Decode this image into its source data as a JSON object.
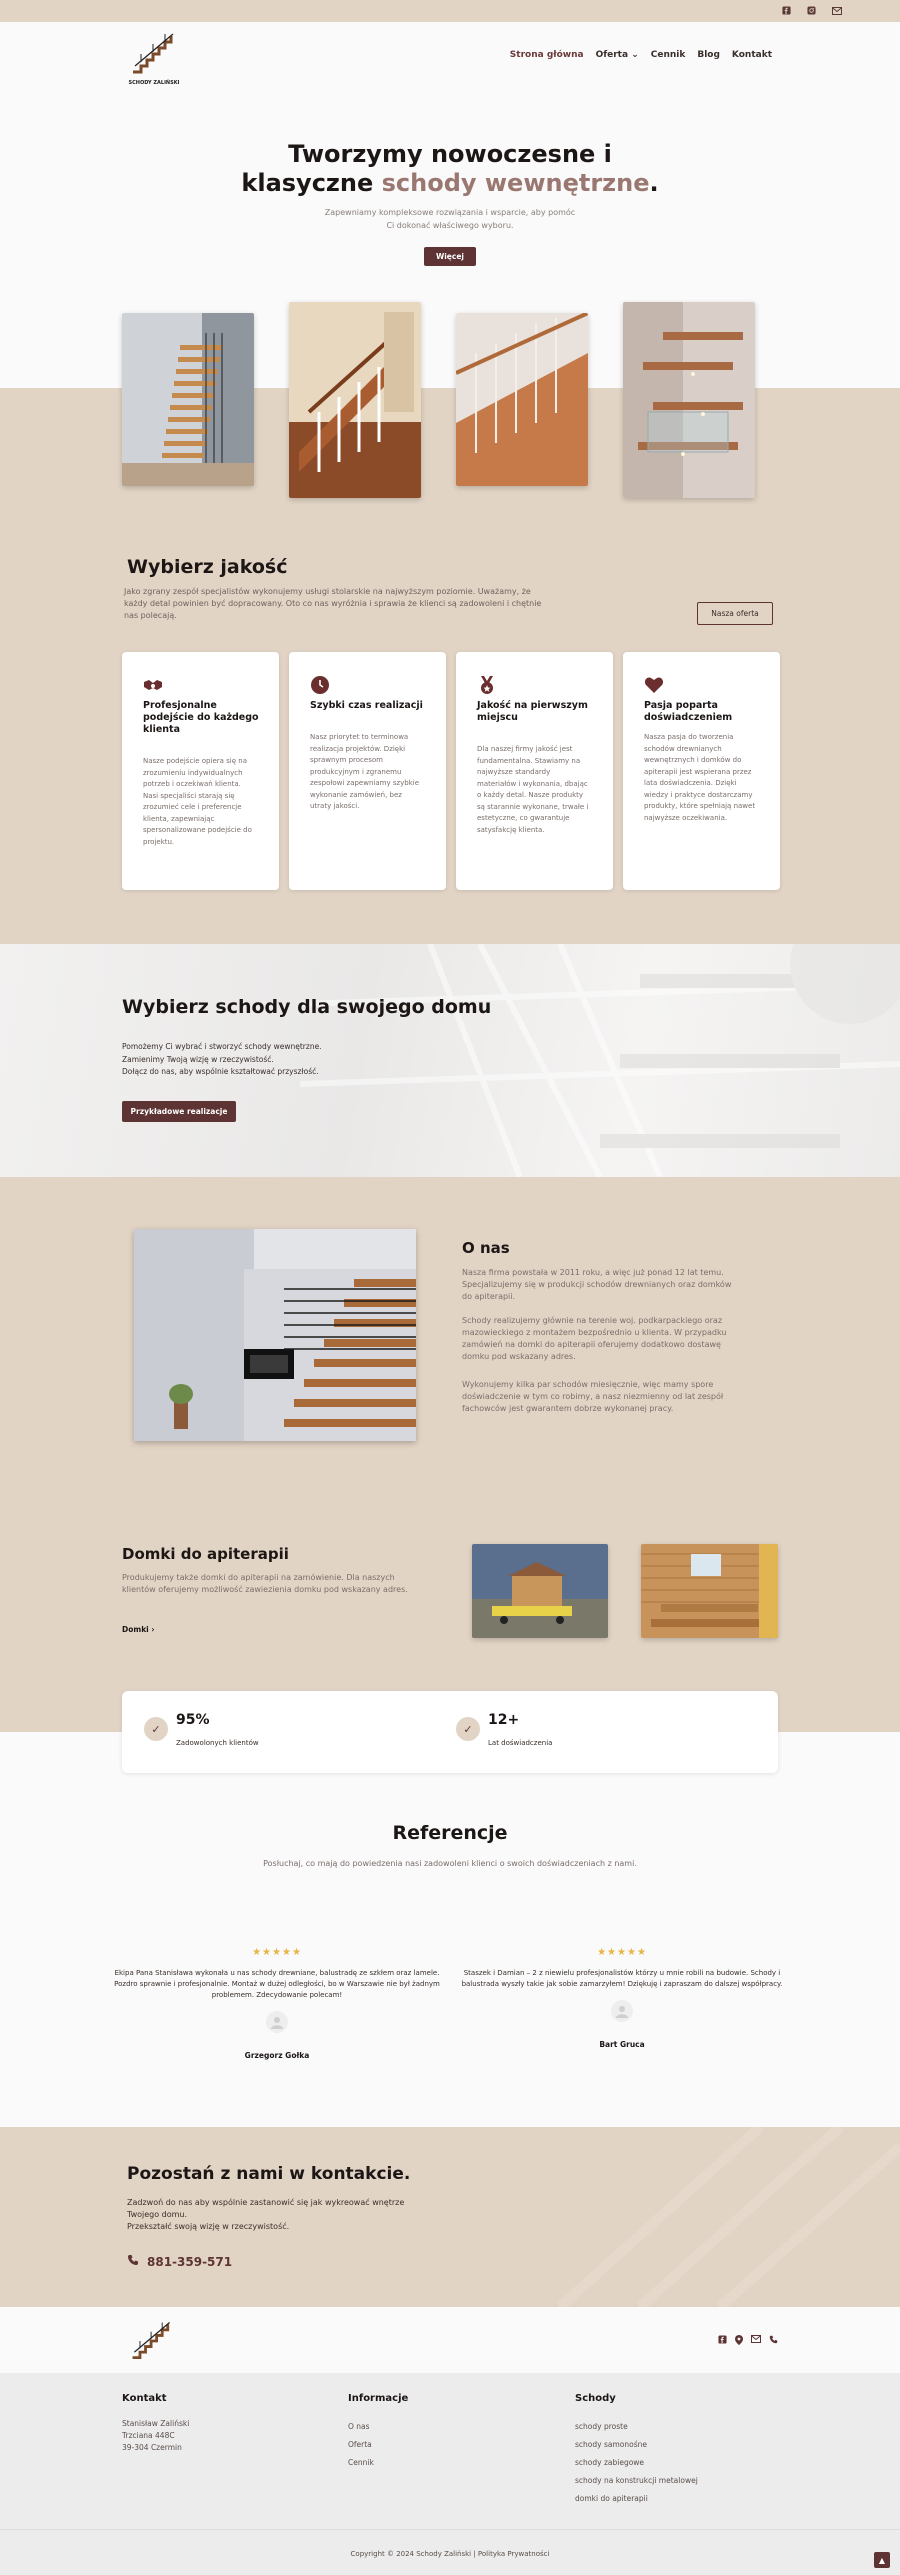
{
  "topbar": {
    "icons": [
      "facebook-icon",
      "instagram-icon",
      "mail-icon"
    ]
  },
  "brand": {
    "name": "SCHODY ZALIŃSKI"
  },
  "nav": {
    "items": [
      {
        "label": "Strona główna"
      },
      {
        "label": "Oferta ⌄"
      },
      {
        "label": "Cennik"
      },
      {
        "label": "Blog"
      },
      {
        "label": "Kontakt"
      }
    ]
  },
  "hero": {
    "title_line1": "Tworzymy nowoczesne i",
    "title_prefix": "klasyczne ",
    "title_accent": "schody wewnętrzne",
    "title_suffix": ".",
    "subtitle_line1": "Zapewniamy kompleksowe rozwiązania i wsparcie, aby pomóc",
    "subtitle_line2": "Ci dokonać właściwego wyboru.",
    "button": "Więcej"
  },
  "quality": {
    "title": "Wybierz jakość",
    "text": "Jako zgrany zespół specjalistów wykonujemy usługi stolarskie na najwyższym poziomie. Uważamy, że każdy detal powinien być dopracowany. Oto co nas wyróżnia i sprawia że klienci są zadowoleni i chętnie nas polecają.",
    "button": "Nasza oferta",
    "cards": [
      {
        "icon": "handshake-icon",
        "title": "Profesjonalne podejście do każdego klienta",
        "text": "Nasze podejście opiera się na zrozumieniu indywidualnych potrzeb i oczekiwań klienta. Nasi specjaliści starają się zrozumieć cele i preferencje klienta, zapewniając spersonalizowane podejście do projektu."
      },
      {
        "icon": "clock-icon",
        "title": "Szybki czas realizacji",
        "text": "Nasz priorytet to terminowa realizacja projektów. Dzięki sprawnym procesom produkcyjnym i zgranemu zespołowi zapewniamy szybkie wykonanie zamówień, bez utraty jakości."
      },
      {
        "icon": "medal-icon",
        "title": "Jakość na pierwszym miejscu",
        "text": "Dla naszej firmy jakość jest fundamentalna. Stawiamy na najwyższe standardy materiałów i wykonania, dbając o każdy detal. Nasze produkty są starannie wykonane, trwałe i estetyczne, co gwarantuje satysfakcję klienta."
      },
      {
        "icon": "heart-icon",
        "title": "Pasja poparta doświadczeniem",
        "text": "Nasza pasja do tworzenia schodów drewnianych wewnętrznych i domków do apiterapii jest wspierana przez lata doświadczenia. Dzięki wiedzy i praktyce dostarczamy produkty, które spełniają nawet najwyższe oczekiwania."
      }
    ]
  },
  "stairs": {
    "title": "Wybierz schody dla swojego domu",
    "line1": "Pomożemy Ci wybrać i stworzyć schody wewnętrzne.",
    "line2": "Zamienimy Twoją wizję w rzeczywistość.",
    "line3": "Dołącz do nas, aby wspólnie kształtować przyszłość.",
    "button": "Przykładowe realizacje"
  },
  "about": {
    "title": "O nas",
    "p1": "Nasza firma powstała w 2011 roku, a więc już ponad 12 lat temu. Specjalizujemy się w produkcji schodów drewnianych oraz domków do apiterapii.",
    "p2": "Schody realizujemy głównie na terenie woj. podkarpackiego oraz mazowieckiego z montażem bezpośrednio u klienta. W przypadku zamówień na domki do apiterapii oferujemy dodatkowo dostawę domku pod wskazany adres.",
    "p3": "Wykonujemy kilka par schodów miesięcznie, więc mamy spore doświadczenie w tym co robimy, a nasz niezmienny od lat zespół fachowców jest gwarantem dobrze wykonanej pracy."
  },
  "domki": {
    "title": "Domki do apiterapii",
    "text": "Produkujemy także domki do apiterapii na zamówienie. Dla naszych klientów oferujemy możliwość zawiezienia domku pod wskazany adres.",
    "link": "Domki ›"
  },
  "stats": [
    {
      "value": "95%",
      "label": "Zadowolonych klientów"
    },
    {
      "value": "12+",
      "label": "Lat doświadczenia"
    }
  ],
  "references": {
    "title": "Referencje",
    "subtitle": "Posłuchaj, co mają do powiedzenia nasi zadowoleni klienci o swoich doświadczeniach z nami.",
    "items": [
      {
        "stars": "★★★★★",
        "text": "Ekipa Pana Stanisława wykonała u nas schody drewniane, balustradę ze szkłem oraz lamele. Pozdro sprawnie i profesjonalnie. Montaż w dużej odległości, bo w Warszawie nie był żadnym problemem. Zdecydowanie polecam!",
        "name": "Grzegorz Gołka"
      },
      {
        "stars": "★★★★★",
        "text": "Staszek i Damian – 2 z niewielu profesjonalistów którzy u mnie robili na budowie. Schody i balustrada wyszły takie jak sobie zamarzyłem! Dziękuję i zapraszam do dalszej współpracy.",
        "name": "Bart Gruca"
      }
    ]
  },
  "contact_cta": {
    "title": "Pozostań z nami w kontakcie.",
    "line1": "Zadzwoń do nas aby wspólnie zastanowić się jak wykreować wnętrze",
    "line2": "Twojego domu.",
    "line3": "Przekształć swoją wizję w rzeczywistość.",
    "phone": "881-359-571"
  },
  "footer": {
    "icons": [
      "facebook-icon",
      "location-icon",
      "mail-icon",
      "phone-icon"
    ],
    "contact": {
      "title": "Kontakt",
      "lines": [
        "Stanisław Zaliński",
        "Trzciana 448C",
        "39-304 Czermin"
      ]
    },
    "info": {
      "title": "Informacje",
      "links": [
        "O nas",
        "Oferta",
        "Cennik"
      ]
    },
    "stairs": {
      "title": "Schody",
      "links": [
        "schody proste",
        "schody samonośne",
        "schody zabiegowe",
        "schody na konstrukcji metalowej",
        "domki do apiterapii"
      ]
    },
    "copyright": "Copyright © 2024 Schody Zaliński | Polityka Prywatności"
  }
}
